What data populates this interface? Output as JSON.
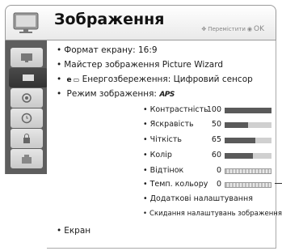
{
  "header": {
    "title": "Зображення",
    "hint": "Перемістити",
    "ok": "OK"
  },
  "sidebar": {
    "items": [
      {
        "icon": "picture-menu-icon"
      },
      {
        "icon": "tv-icon"
      },
      {
        "icon": "audio-icon"
      },
      {
        "icon": "clock-icon"
      },
      {
        "icon": "lock-icon"
      },
      {
        "icon": "options-icon"
      }
    ]
  },
  "menu": {
    "aspect": "Формат екрану: 16:9",
    "wizard": "Майстер зображення Picture Wizard",
    "eco_prefix": "e",
    "energy": "Енергозбереження: Цифровий сенсор",
    "mode": "Режим зображення:",
    "aps": "APS",
    "screen": "Екран"
  },
  "settings": [
    {
      "label": "Контрастність",
      "value": "100",
      "fraction": 1.0
    },
    {
      "label": "Яскравість",
      "value": "50",
      "fraction": 0.5
    },
    {
      "label": "Чіткість",
      "value": "65",
      "fraction": 0.65
    },
    {
      "label": "Колір",
      "value": "60",
      "fraction": 0.6
    },
    {
      "label": "Відтінок",
      "value": "0",
      "fraction": 0
    },
    {
      "label": "Темп. кольору",
      "value": "0",
      "fraction": 0
    }
  ],
  "extra": {
    "advanced": "Додаткові налаштування",
    "reset": "Скидання налаштувань зображення"
  }
}
